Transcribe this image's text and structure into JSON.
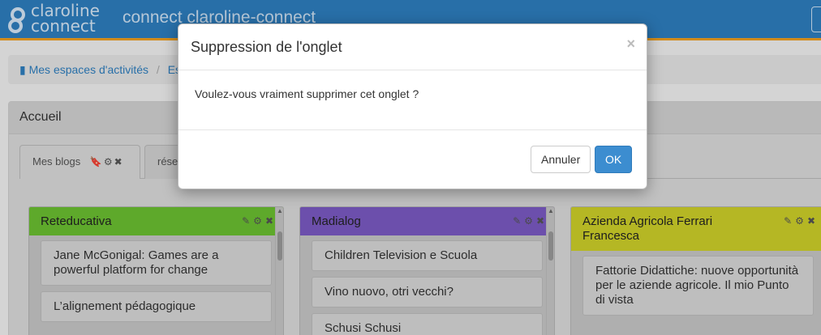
{
  "navbar": {
    "logo_line1": "claroline",
    "logo_line2": "connect",
    "title": "connect claroline-connect"
  },
  "breadcrumb": {
    "item1": "Mes espaces d'activités",
    "item2": "Es"
  },
  "panel": {
    "heading": "Accueil",
    "tabs": [
      {
        "label": "Mes blogs"
      },
      {
        "label": "rése"
      }
    ]
  },
  "columns": [
    {
      "title": "Reteducativa",
      "color": "#6cc132",
      "posts": [
        "Jane McGonigal: Games are a powerful platform for change",
        "L’alignement pédagogique"
      ]
    },
    {
      "title": "Madialog",
      "color": "#7b5bc4",
      "posts": [
        "Children Television e Scuola",
        "Vino nuovo, otri vecchi?",
        "Schusi Schusi"
      ]
    },
    {
      "title": "Azienda Agricola Ferrari Francesca",
      "color": "#cfd12a",
      "posts": [
        "Fattorie Didattiche: nuove opportunità per le aziende agricole. Il mio Punto di vista"
      ]
    }
  ],
  "modal": {
    "title": "Suppression de l'onglet",
    "close": "×",
    "message": "Voulez-vous vraiment supprimer cet onglet ?",
    "cancel_label": "Annuler",
    "ok_label": "OK"
  },
  "icons": {
    "tab_icons": "🔖⚙✖",
    "column_tools": "✎⚙✖"
  }
}
